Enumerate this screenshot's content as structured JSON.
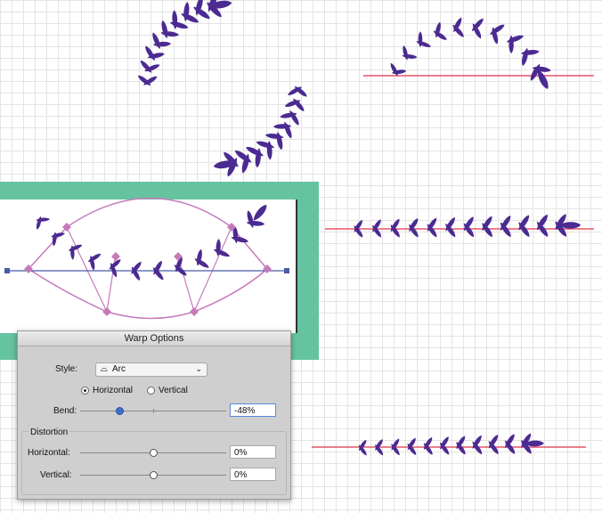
{
  "dialog": {
    "title": "Warp Options",
    "style_label": "Style:",
    "style_value": "Arc",
    "style_icon": "arc-icon",
    "orientation": {
      "horizontal_label": "Horizontal",
      "vertical_label": "Vertical",
      "selected": "Horizontal"
    },
    "bend": {
      "label": "Bend:",
      "value": "-48%",
      "level": -0.48
    },
    "distortion": {
      "group_label": "Distortion",
      "horizontal": {
        "label": "Horizontal:",
        "value": "0%",
        "level": 0
      },
      "vertical": {
        "label": "Vertical:",
        "value": "0%",
        "level": 0
      }
    }
  },
  "colors": {
    "leaf": "#4b2a91",
    "baseline": "#e0334c",
    "envelope": "#c77ab9",
    "anchor": "#4b5aa8",
    "frame": "#66c3a0"
  }
}
